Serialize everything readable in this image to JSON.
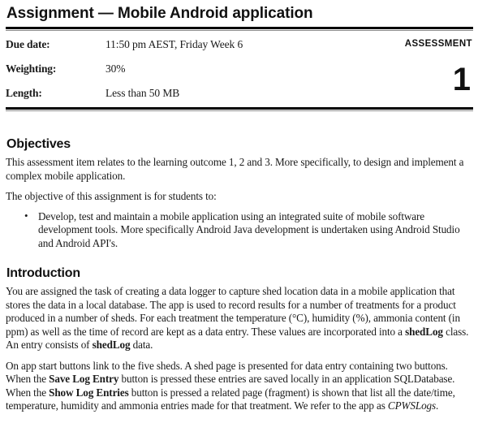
{
  "header": {
    "title": "Assignment  — Mobile Android application",
    "assessment_label": "ASSESSMENT",
    "assessment_number": "1",
    "meta": [
      {
        "label": "Due date:",
        "value": "11:50 pm AEST, Friday Week 6"
      },
      {
        "label": "Weighting:",
        "value": "30%"
      },
      {
        "label": "Length:",
        "value": "Less than 50 MB"
      }
    ]
  },
  "objectives": {
    "heading": "Objectives",
    "paragraph_1": "This assessment item relates to the learning outcome 1, 2 and 3. More specifically, to design and implement a complex mobile application.",
    "paragraph_2": "The objective of this assignment is for students to:",
    "bullets": [
      "Develop, test and maintain a mobile application using an integrated suite of mobile software development tools. More specifically Android Java development is undertaken using Android Studio and Android API's."
    ]
  },
  "introduction": {
    "heading": "Introduction",
    "paragraph_1": {
      "part_1": "You are assigned the task of creating a data logger to capture shed location data in a mobile application that stores the data in a local database. The app is used to record results for a number of treatments for a product produced in a number of sheds. For each treatment the temperature (°C), humidity (%), ammonia content (in ppm) as well as the time of record are kept as a data entry. These values are incorporated into a ",
      "bold_1": "shedLog",
      "part_2": " class. An entry consists of ",
      "bold_2": "shedLog",
      "part_3": " data."
    },
    "paragraph_2": {
      "part_1": "On app start buttons link to the five sheds. A shed page is presented for data entry containing two buttons. When the ",
      "bold_1": "Save Log Entry",
      "part_2": " button is pressed these entries are saved locally in an application SQLDatabase. When the ",
      "bold_2": "Show Log Entries",
      "part_3": " button is pressed a related page (fragment) is shown that list all the date/time, temperature, humidity and ammonia entries made for that treatment. We refer to the app as ",
      "italic_1": "CPWSLogs",
      "part_4": "."
    }
  },
  "colors": {
    "text": "#1a1a1a",
    "rule_dark": "#000000",
    "rule_light": "#8a8a8a",
    "background": "#ffffff"
  }
}
